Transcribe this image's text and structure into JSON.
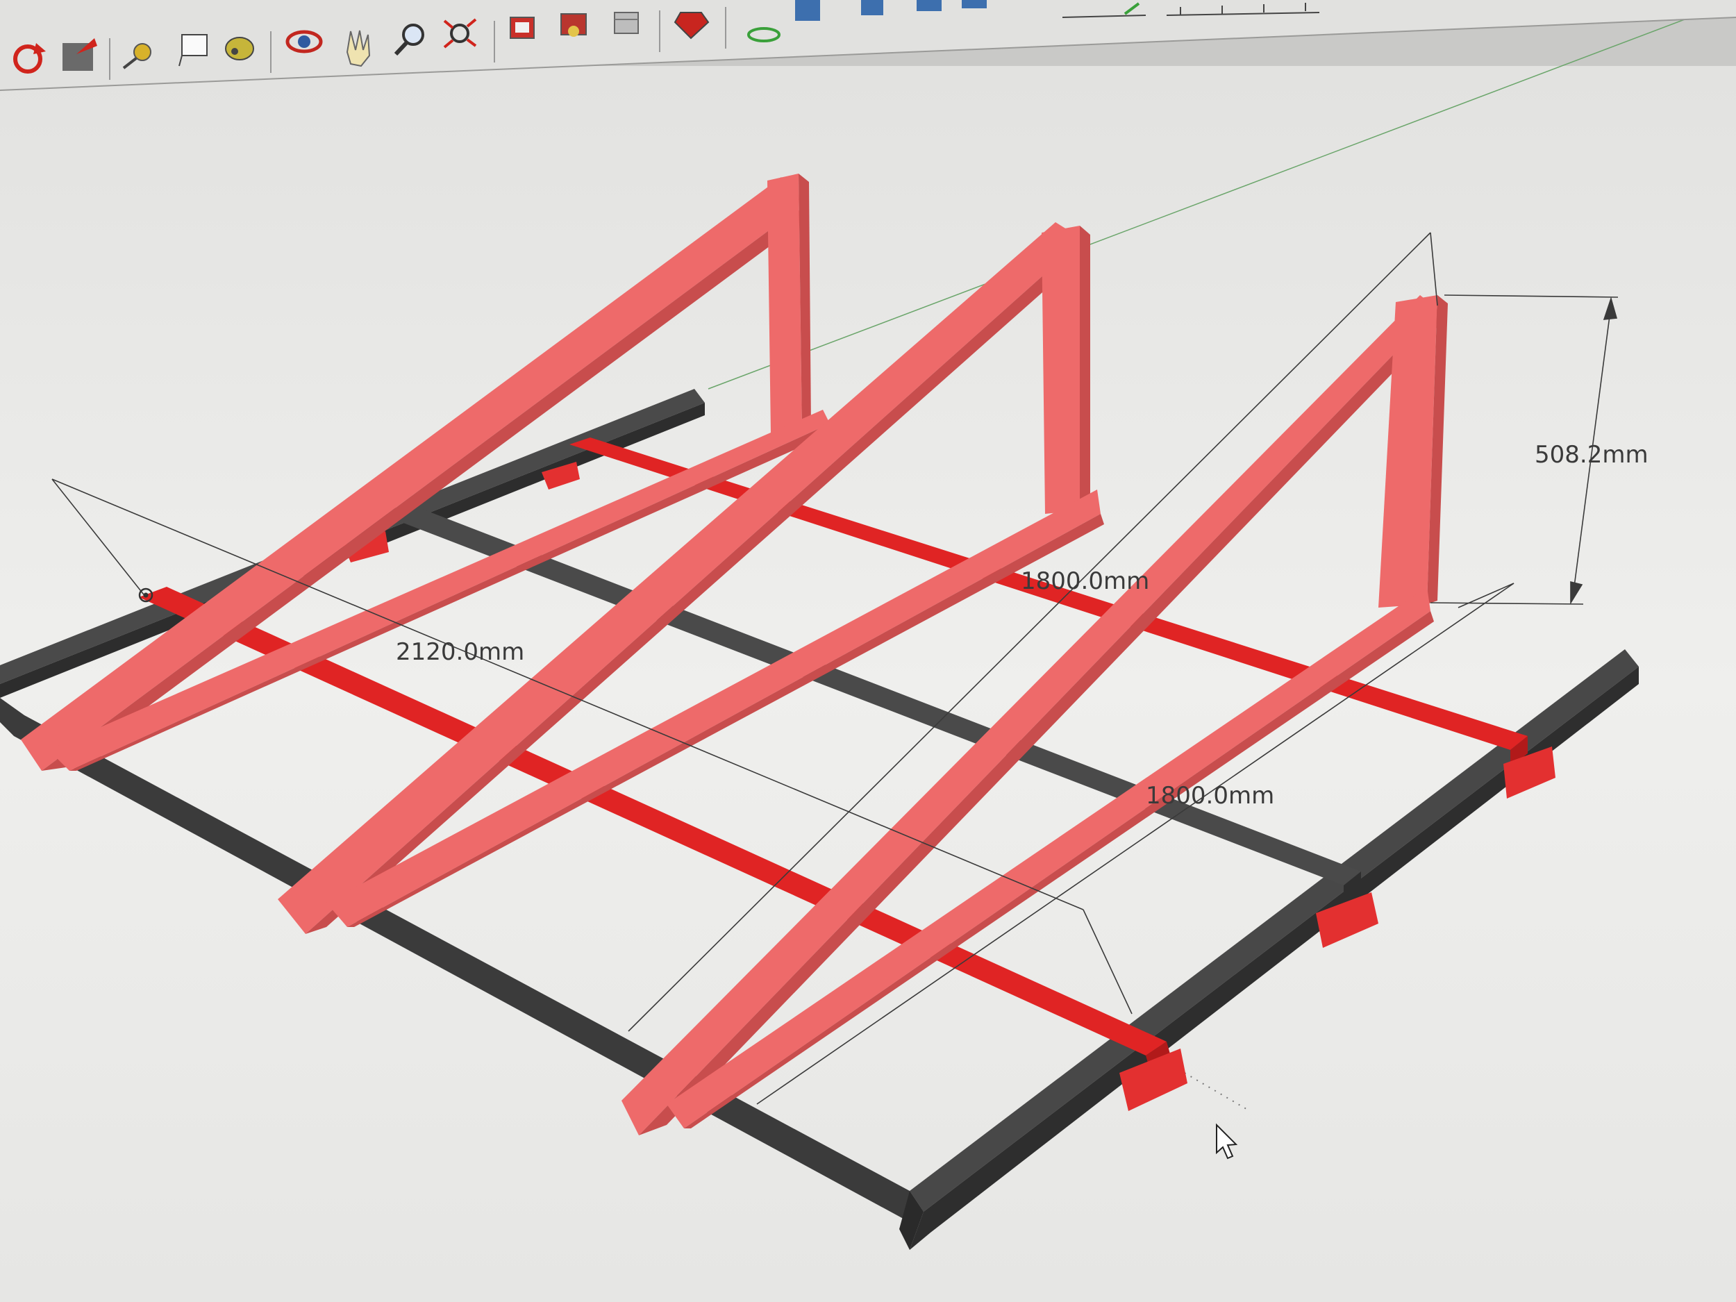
{
  "dimensions": {
    "height": "508.2mm",
    "depth_top": "1800.0mm",
    "depth_bottom": "1800.0mm",
    "width": "2120.0mm"
  },
  "toolbar": {
    "icons": [
      "refresh-icon",
      "push-pull-icon",
      "tape-measure-icon",
      "text-label-icon",
      "paint-bucket-icon",
      "orbit-icon",
      "pan-icon",
      "zoom-icon",
      "zoom-extents-icon",
      "warehouse-icon",
      "extension-icon",
      "section-icon",
      "ruby-icon",
      "standard-views-icons",
      "scale-toolbar-icons"
    ]
  },
  "colors": {
    "viewport": "#efefed",
    "rafter": "#ee6a6a",
    "cross_beam": "#e02424",
    "base_frame": "#3d3d3d"
  }
}
